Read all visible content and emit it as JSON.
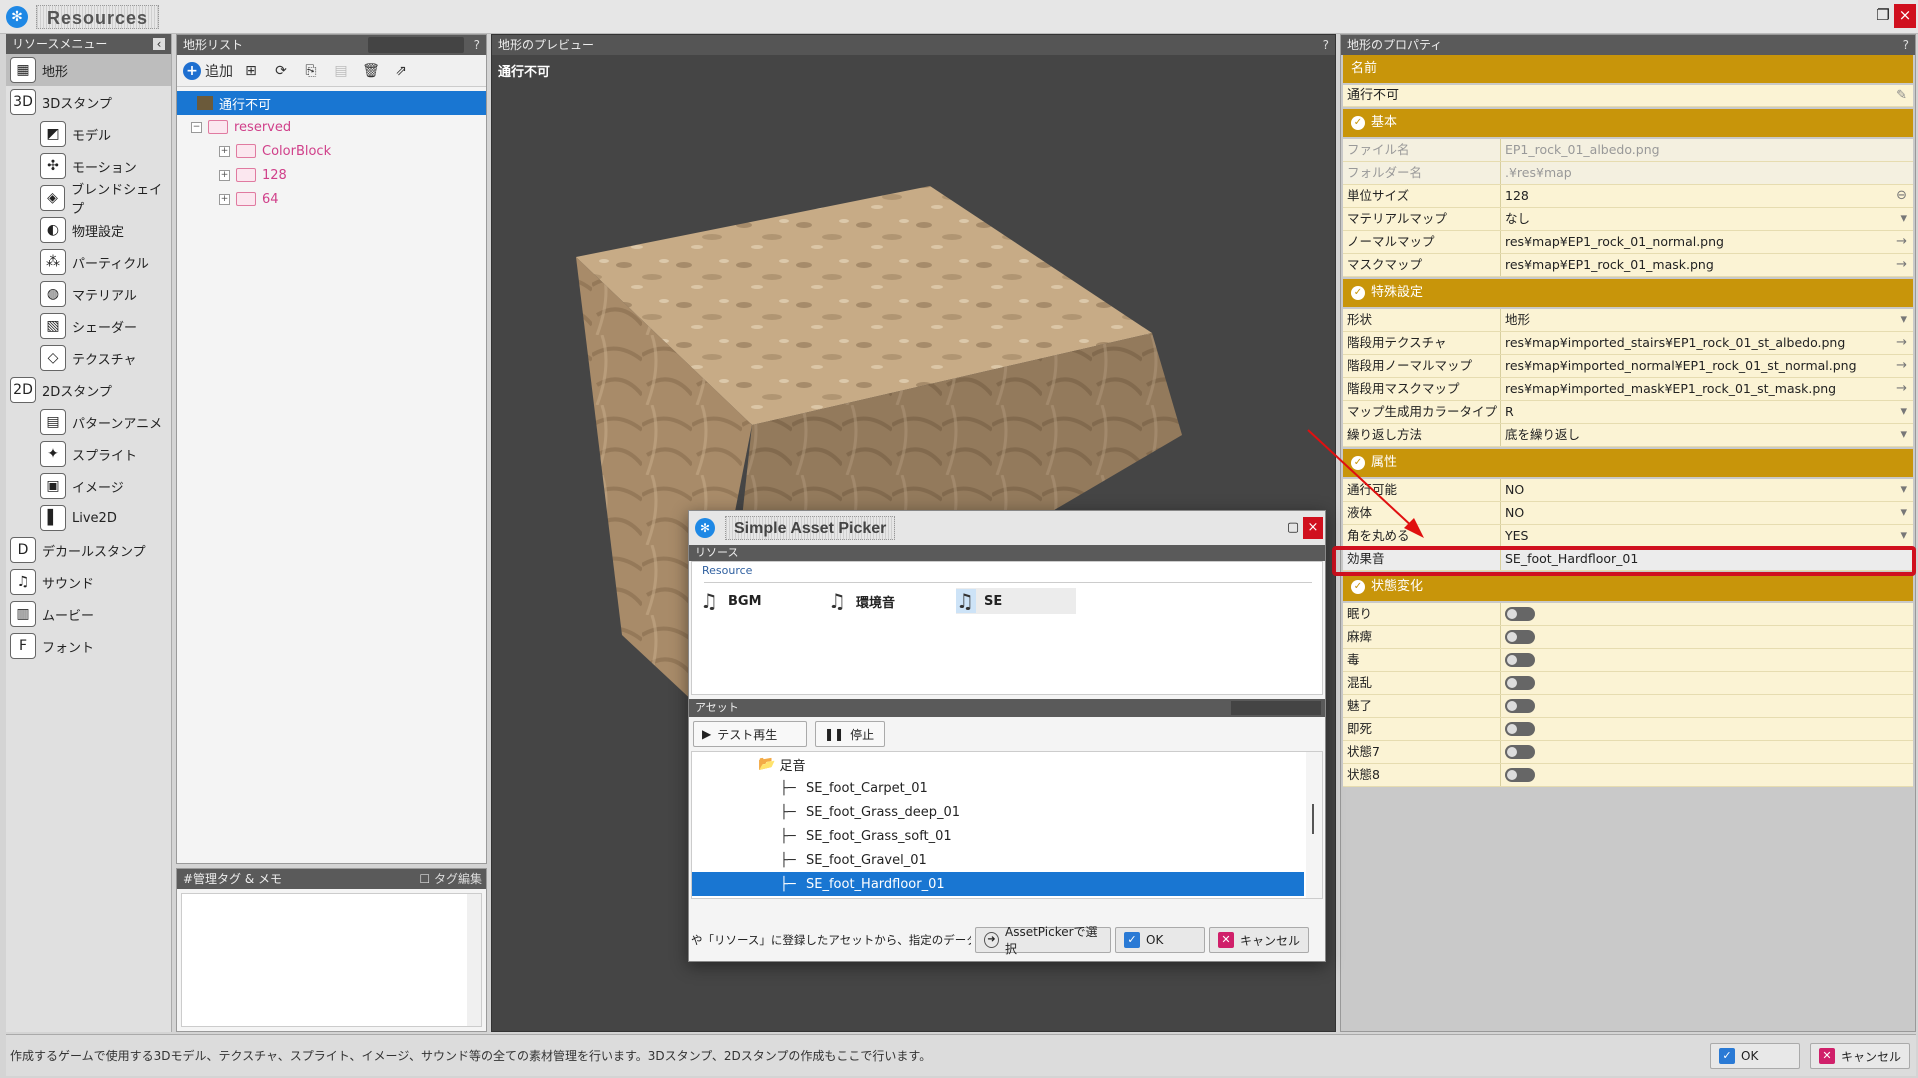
{
  "window": {
    "title": "Resources"
  },
  "left_menu": {
    "header": "リソースメニュー",
    "items": [
      {
        "label": "地形",
        "icon": "terrain-icon",
        "level": 1,
        "selected": true
      },
      {
        "label": "3Dスタンプ",
        "icon": "3d-icon",
        "level": 1
      },
      {
        "label": "モデル",
        "icon": "model-icon",
        "level": 2
      },
      {
        "label": "モーション",
        "icon": "motion-icon",
        "level": 2
      },
      {
        "label": "ブレンドシェイプ",
        "icon": "blendshape-icon",
        "level": 2
      },
      {
        "label": "物理設定",
        "icon": "physics-icon",
        "level": 2
      },
      {
        "label": "パーティクル",
        "icon": "particle-icon",
        "level": 2
      },
      {
        "label": "マテリアル",
        "icon": "material-icon",
        "level": 2
      },
      {
        "label": "シェーダー",
        "icon": "shader-icon",
        "level": 2
      },
      {
        "label": "テクスチャ",
        "icon": "texture-icon",
        "level": 2
      },
      {
        "label": "2Dスタンプ",
        "icon": "2d-icon",
        "level": 1
      },
      {
        "label": "パターンアニメ",
        "icon": "pattern-anim-icon",
        "level": 2
      },
      {
        "label": "スプライト",
        "icon": "sprite-icon",
        "level": 2
      },
      {
        "label": "イメージ",
        "icon": "image-icon",
        "level": 2
      },
      {
        "label": "Live2D",
        "icon": "live2d-icon",
        "level": 2
      },
      {
        "label": "デカールスタンプ",
        "icon": "decal-icon",
        "level": 1
      },
      {
        "label": "サウンド",
        "icon": "sound-icon",
        "level": 1
      },
      {
        "label": "ムービー",
        "icon": "movie-icon",
        "level": 1
      },
      {
        "label": "フォント",
        "icon": "font-icon",
        "level": 1
      }
    ]
  },
  "list_panel": {
    "header": "地形リスト",
    "help": "?",
    "add_label": "追加",
    "tree": [
      {
        "label": "通行不可",
        "selected": true
      },
      {
        "label": "reserved"
      },
      {
        "label": "ColorBlock"
      },
      {
        "label": "128"
      },
      {
        "label": "64"
      }
    ]
  },
  "tag_panel": {
    "header": "#管理タグ & メモ",
    "edit_label": "タグ編集"
  },
  "preview": {
    "header": "地形のプレビュー",
    "help": "?",
    "label": "通行不可"
  },
  "props": {
    "header": "地形のプロパティ",
    "help": "?",
    "name_section": "名前",
    "name_value": "通行不可",
    "sections": [
      {
        "title": "基本",
        "rows": [
          {
            "key": "ファイル名",
            "value": "EP1_rock_01_albedo.png",
            "dim": true
          },
          {
            "key": "フォルダー名",
            "value": ".¥res¥map",
            "dim": true
          },
          {
            "key": "単位サイズ",
            "value": "128"
          },
          {
            "key": "マテリアルマップ",
            "value": "なし"
          },
          {
            "key": "ノーマルマップ",
            "value": "res¥map¥EP1_rock_01_normal.png"
          },
          {
            "key": "マスクマップ",
            "value": "res¥map¥EP1_rock_01_mask.png"
          }
        ]
      },
      {
        "title": "特殊設定",
        "rows": [
          {
            "key": "形状",
            "value": "地形"
          },
          {
            "key": "階段用テクスチャ",
            "value": "res¥map¥imported_stairs¥EP1_rock_01_st_albedo.png"
          },
          {
            "key": "階段用ノーマルマップ",
            "value": "res¥map¥imported_normal¥EP1_rock_01_st_normal.png"
          },
          {
            "key": "階段用マスクマップ",
            "value": "res¥map¥imported_mask¥EP1_rock_01_st_mask.png"
          },
          {
            "key": "マップ生成用カラータイプ",
            "value": "R"
          },
          {
            "key": "繰り返し方法",
            "value": "底を繰り返し"
          }
        ]
      },
      {
        "title": "属性",
        "rows": [
          {
            "key": "通行可能",
            "value": "NO"
          },
          {
            "key": "液体",
            "value": "NO"
          },
          {
            "key": "角を丸める",
            "value": "YES"
          },
          {
            "key": "効果音",
            "value": "SE_foot_Hardfloor_01",
            "highlight": true
          }
        ]
      },
      {
        "title": "状態変化",
        "rows": [
          {
            "key": "眠り",
            "toggle": true
          },
          {
            "key": "麻痺",
            "toggle": true
          },
          {
            "key": "毒",
            "toggle": true
          },
          {
            "key": "混乱",
            "toggle": true
          },
          {
            "key": "魅了",
            "toggle": true
          },
          {
            "key": "即死",
            "toggle": true
          },
          {
            "key": "状態7",
            "toggle": true
          },
          {
            "key": "状態8",
            "toggle": true
          }
        ]
      }
    ]
  },
  "dialog": {
    "title": "Simple Asset Picker",
    "resource_header": "リソース",
    "resource_label": "Resource",
    "resources": [
      "BGM",
      "環境音",
      "SE"
    ],
    "asset_header": "アセット",
    "play_label": "テスト再生",
    "stop_label": "停止",
    "folder": "足音",
    "assets": [
      "SE_foot_Carpet_01",
      "SE_foot_Grass_deep_01",
      "SE_foot_Grass_soft_01",
      "SE_foot_Gravel_01",
      "SE_foot_Hardfloor_01"
    ],
    "hint": "や「リソース」に登録したアセットから、指定のデータを設定",
    "assetpicker_label": "AssetPickerで選択",
    "ok_label": "OK",
    "cancel_label": "キャンセル"
  },
  "status": {
    "message": "作成するゲームで使用する3Dモデル、テクスチャ、スプライト、イメージ、サウンド等の全ての素材管理を行います。3Dスタンプ、2Dスタンプの作成もここで行います。",
    "ok_label": "OK",
    "cancel_label": "キャンセル"
  },
  "colors": {
    "accent": "#1976d2",
    "section": "#c8950a",
    "highlight": "#d0101e"
  }
}
